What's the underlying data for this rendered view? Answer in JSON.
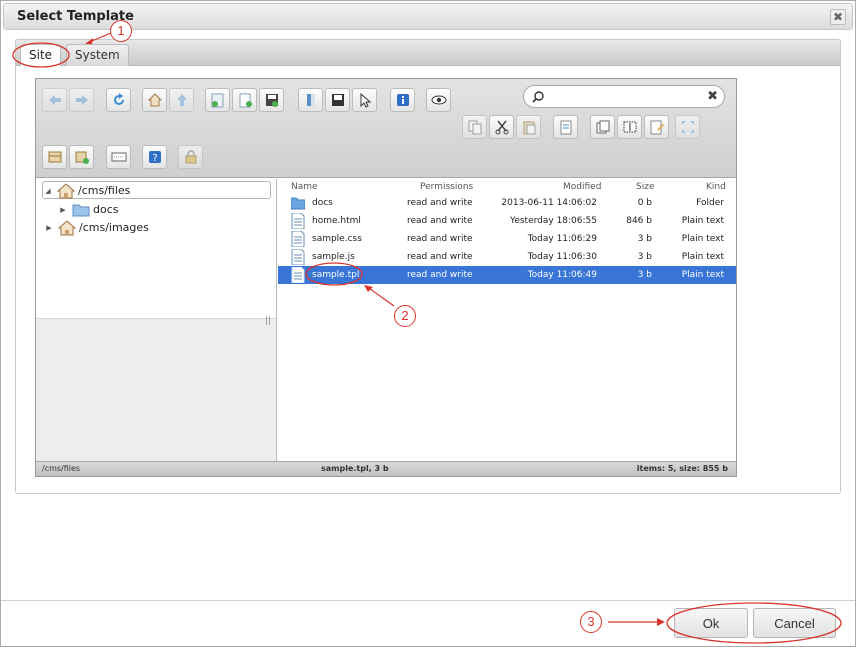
{
  "dialog": {
    "title": "Select Template",
    "close_glyph": "✖"
  },
  "tabs": [
    {
      "label": "Site",
      "active": true
    },
    {
      "label": "System",
      "active": false
    }
  ],
  "toolbar": {
    "search_placeholder": "",
    "search_clear_glyph": "✖",
    "icons": [
      "back-icon",
      "forward-icon",
      "reload-icon",
      "home-icon",
      "up-icon",
      "new-folder-icon",
      "new-file-icon",
      "upload-icon",
      "open-icon",
      "save-icon",
      "select-icon",
      "info-icon",
      "preview-icon",
      "copy-icon",
      "cut-icon",
      "paste-icon",
      "duplicate-icon",
      "rename-icon",
      "edit-icon",
      "resize-icon",
      "fullscreen-icon",
      "archive-icon",
      "extract-icon",
      "view-icon",
      "help-icon",
      "lock-icon"
    ]
  },
  "tree": {
    "items": [
      {
        "label": "/cms/files",
        "expanded": true
      },
      {
        "label": "docs"
      },
      {
        "label": "/cms/images",
        "expanded": false
      }
    ],
    "grip": "||"
  },
  "list": {
    "columns": [
      "Name",
      "Permissions",
      "Modified",
      "Size",
      "Kind"
    ],
    "rows": [
      {
        "name": "docs",
        "permissions": "read and write",
        "modified": "2013-06-11 14:06:02",
        "size": "0 b",
        "kind": "Folder",
        "type": "folder"
      },
      {
        "name": "home.html",
        "permissions": "read and write",
        "modified": "Yesterday 18:06:55",
        "size": "846 b",
        "kind": "Plain text",
        "type": "file"
      },
      {
        "name": "sample.css",
        "permissions": "read and write",
        "modified": "Today 11:06:29",
        "size": "3 b",
        "kind": "Plain text",
        "type": "file"
      },
      {
        "name": "sample.js",
        "permissions": "read and write",
        "modified": "Today 11:06:30",
        "size": "3 b",
        "kind": "Plain text",
        "type": "file"
      },
      {
        "name": "sample.tpl",
        "permissions": "read and write",
        "modified": "Today 11:06:49",
        "size": "3 b",
        "kind": "Plain text",
        "type": "file",
        "selected": true
      }
    ]
  },
  "status": {
    "path": "/cms/files",
    "selection": "sample.tpl, 3 b",
    "summary": "items: 5, size: 855 b"
  },
  "buttons": {
    "ok": "Ok",
    "cancel": "Cancel"
  },
  "annotations": [
    "1",
    "2",
    "3"
  ],
  "colors": {
    "selection": "#3875d7",
    "annotation": "#d9342b"
  }
}
